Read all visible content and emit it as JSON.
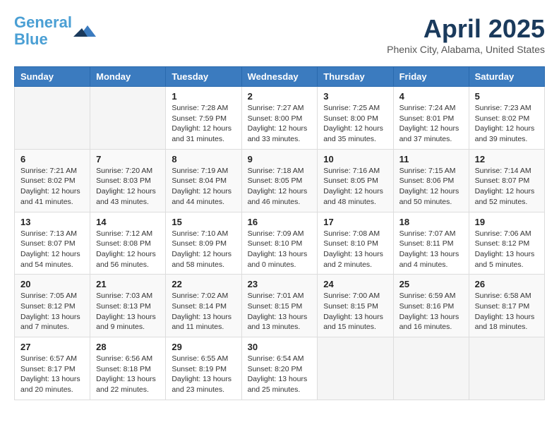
{
  "header": {
    "logo_line1": "General",
    "logo_line2": "Blue",
    "month_title": "April 2025",
    "location": "Phenix City, Alabama, United States"
  },
  "weekdays": [
    "Sunday",
    "Monday",
    "Tuesday",
    "Wednesday",
    "Thursday",
    "Friday",
    "Saturday"
  ],
  "weeks": [
    [
      {
        "day": "",
        "info": ""
      },
      {
        "day": "",
        "info": ""
      },
      {
        "day": "1",
        "info": "Sunrise: 7:28 AM\nSunset: 7:59 PM\nDaylight: 12 hours and 31 minutes."
      },
      {
        "day": "2",
        "info": "Sunrise: 7:27 AM\nSunset: 8:00 PM\nDaylight: 12 hours and 33 minutes."
      },
      {
        "day": "3",
        "info": "Sunrise: 7:25 AM\nSunset: 8:00 PM\nDaylight: 12 hours and 35 minutes."
      },
      {
        "day": "4",
        "info": "Sunrise: 7:24 AM\nSunset: 8:01 PM\nDaylight: 12 hours and 37 minutes."
      },
      {
        "day": "5",
        "info": "Sunrise: 7:23 AM\nSunset: 8:02 PM\nDaylight: 12 hours and 39 minutes."
      }
    ],
    [
      {
        "day": "6",
        "info": "Sunrise: 7:21 AM\nSunset: 8:02 PM\nDaylight: 12 hours and 41 minutes."
      },
      {
        "day": "7",
        "info": "Sunrise: 7:20 AM\nSunset: 8:03 PM\nDaylight: 12 hours and 43 minutes."
      },
      {
        "day": "8",
        "info": "Sunrise: 7:19 AM\nSunset: 8:04 PM\nDaylight: 12 hours and 44 minutes."
      },
      {
        "day": "9",
        "info": "Sunrise: 7:18 AM\nSunset: 8:05 PM\nDaylight: 12 hours and 46 minutes."
      },
      {
        "day": "10",
        "info": "Sunrise: 7:16 AM\nSunset: 8:05 PM\nDaylight: 12 hours and 48 minutes."
      },
      {
        "day": "11",
        "info": "Sunrise: 7:15 AM\nSunset: 8:06 PM\nDaylight: 12 hours and 50 minutes."
      },
      {
        "day": "12",
        "info": "Sunrise: 7:14 AM\nSunset: 8:07 PM\nDaylight: 12 hours and 52 minutes."
      }
    ],
    [
      {
        "day": "13",
        "info": "Sunrise: 7:13 AM\nSunset: 8:07 PM\nDaylight: 12 hours and 54 minutes."
      },
      {
        "day": "14",
        "info": "Sunrise: 7:12 AM\nSunset: 8:08 PM\nDaylight: 12 hours and 56 minutes."
      },
      {
        "day": "15",
        "info": "Sunrise: 7:10 AM\nSunset: 8:09 PM\nDaylight: 12 hours and 58 minutes."
      },
      {
        "day": "16",
        "info": "Sunrise: 7:09 AM\nSunset: 8:10 PM\nDaylight: 13 hours and 0 minutes."
      },
      {
        "day": "17",
        "info": "Sunrise: 7:08 AM\nSunset: 8:10 PM\nDaylight: 13 hours and 2 minutes."
      },
      {
        "day": "18",
        "info": "Sunrise: 7:07 AM\nSunset: 8:11 PM\nDaylight: 13 hours and 4 minutes."
      },
      {
        "day": "19",
        "info": "Sunrise: 7:06 AM\nSunset: 8:12 PM\nDaylight: 13 hours and 5 minutes."
      }
    ],
    [
      {
        "day": "20",
        "info": "Sunrise: 7:05 AM\nSunset: 8:12 PM\nDaylight: 13 hours and 7 minutes."
      },
      {
        "day": "21",
        "info": "Sunrise: 7:03 AM\nSunset: 8:13 PM\nDaylight: 13 hours and 9 minutes."
      },
      {
        "day": "22",
        "info": "Sunrise: 7:02 AM\nSunset: 8:14 PM\nDaylight: 13 hours and 11 minutes."
      },
      {
        "day": "23",
        "info": "Sunrise: 7:01 AM\nSunset: 8:15 PM\nDaylight: 13 hours and 13 minutes."
      },
      {
        "day": "24",
        "info": "Sunrise: 7:00 AM\nSunset: 8:15 PM\nDaylight: 13 hours and 15 minutes."
      },
      {
        "day": "25",
        "info": "Sunrise: 6:59 AM\nSunset: 8:16 PM\nDaylight: 13 hours and 16 minutes."
      },
      {
        "day": "26",
        "info": "Sunrise: 6:58 AM\nSunset: 8:17 PM\nDaylight: 13 hours and 18 minutes."
      }
    ],
    [
      {
        "day": "27",
        "info": "Sunrise: 6:57 AM\nSunset: 8:17 PM\nDaylight: 13 hours and 20 minutes."
      },
      {
        "day": "28",
        "info": "Sunrise: 6:56 AM\nSunset: 8:18 PM\nDaylight: 13 hours and 22 minutes."
      },
      {
        "day": "29",
        "info": "Sunrise: 6:55 AM\nSunset: 8:19 PM\nDaylight: 13 hours and 23 minutes."
      },
      {
        "day": "30",
        "info": "Sunrise: 6:54 AM\nSunset: 8:20 PM\nDaylight: 13 hours and 25 minutes."
      },
      {
        "day": "",
        "info": ""
      },
      {
        "day": "",
        "info": ""
      },
      {
        "day": "",
        "info": ""
      }
    ]
  ]
}
